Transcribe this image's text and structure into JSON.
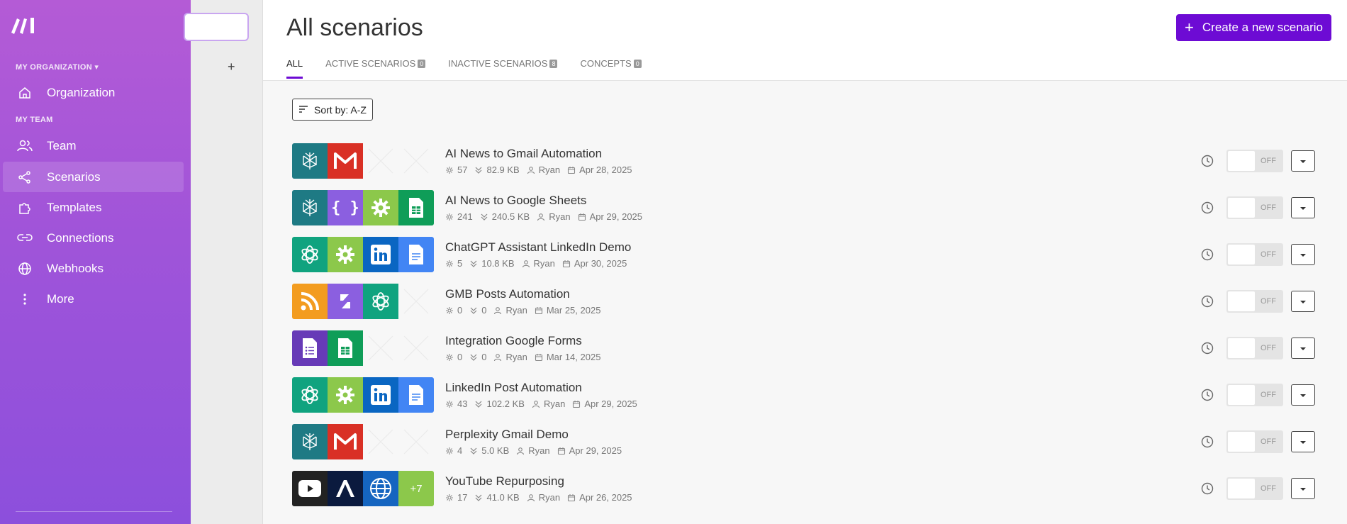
{
  "sidebar": {
    "logo_icon": "make-logo-icon",
    "org_heading": "MY ORGANIZATION",
    "team_heading": "MY TEAM",
    "items": [
      {
        "label": "Organization",
        "icon": "home-icon"
      },
      {
        "label": "Team",
        "icon": "users-icon"
      },
      {
        "label": "Scenarios",
        "icon": "share-nodes-icon"
      },
      {
        "label": "Templates",
        "icon": "puzzle-icon"
      },
      {
        "label": "Connections",
        "icon": "link-icon"
      },
      {
        "label": "Webhooks",
        "icon": "globe-icon"
      },
      {
        "label": "More",
        "icon": "more-vertical-icon"
      }
    ]
  },
  "subpanel": {
    "add_label": "+"
  },
  "header": {
    "title": "All scenarios",
    "create_button": "Create a new scenario",
    "tabs": [
      {
        "label": "ALL",
        "count": ""
      },
      {
        "label": "ACTIVE SCENARIOS",
        "count": "0"
      },
      {
        "label": "INACTIVE SCENARIOS",
        "count": "8"
      },
      {
        "label": "CONCEPTS",
        "count": "0"
      }
    ]
  },
  "sort": {
    "label": "Sort by: A-Z"
  },
  "colors": {
    "accent": "#6d0bd4",
    "sidebar_top": "#b45bd6",
    "sidebar_bottom": "#8c4fdc"
  },
  "scenarios": [
    {
      "name": "AI News to Gmail Automation",
      "operations": "57",
      "data": "82.9 KB",
      "owner": "Ryan",
      "date": "Apr 28, 2025",
      "status": "OFF",
      "apps": [
        {
          "icon": "perplexity-icon",
          "color": "#1e7a84"
        },
        {
          "icon": "gmail-icon",
          "color": "#d93025"
        },
        {
          "icon": "empty",
          "color": ""
        },
        {
          "icon": "empty",
          "color": ""
        }
      ]
    },
    {
      "name": "AI News to Google Sheets",
      "operations": "241",
      "data": "240.5 KB",
      "owner": "Ryan",
      "date": "Apr 29, 2025",
      "status": "OFF",
      "apps": [
        {
          "icon": "perplexity-icon",
          "color": "#1e7a84"
        },
        {
          "icon": "json-icon",
          "color": "#8b5fe0"
        },
        {
          "icon": "tools-gear-icon",
          "color": "#8cc84b"
        },
        {
          "icon": "google-sheets-icon",
          "color": "#0f9d58"
        }
      ]
    },
    {
      "name": "ChatGPT Assistant LinkedIn Demo",
      "operations": "5",
      "data": "10.8 KB",
      "owner": "Ryan",
      "date": "Apr 30, 2025",
      "status": "OFF",
      "apps": [
        {
          "icon": "openai-icon",
          "color": "#10a37f"
        },
        {
          "icon": "tools-gear-icon",
          "color": "#8cc84b"
        },
        {
          "icon": "linkedin-icon",
          "color": "#0a66c2"
        },
        {
          "icon": "google-docs-icon",
          "color": "#4285f4"
        }
      ]
    },
    {
      "name": "GMB Posts Automation",
      "operations": "0",
      "data": "0",
      "owner": "Ryan",
      "date": "Mar 25, 2025",
      "status": "OFF",
      "apps": [
        {
          "icon": "rss-icon",
          "color": "#f39c1f"
        },
        {
          "icon": "flow-control-icon",
          "color": "#8b5fe0"
        },
        {
          "icon": "openai-icon",
          "color": "#10a37f"
        },
        {
          "icon": "empty",
          "color": ""
        }
      ]
    },
    {
      "name": "Integration Google Forms",
      "operations": "0",
      "data": "0",
      "owner": "Ryan",
      "date": "Mar 14, 2025",
      "status": "OFF",
      "apps": [
        {
          "icon": "google-forms-icon",
          "color": "#673ab7"
        },
        {
          "icon": "google-sheets-icon",
          "color": "#0f9d58"
        },
        {
          "icon": "empty",
          "color": ""
        },
        {
          "icon": "empty",
          "color": ""
        }
      ]
    },
    {
      "name": "LinkedIn Post Automation",
      "operations": "43",
      "data": "102.2 KB",
      "owner": "Ryan",
      "date": "Apr 29, 2025",
      "status": "OFF",
      "apps": [
        {
          "icon": "openai-icon",
          "color": "#10a37f"
        },
        {
          "icon": "tools-gear-icon",
          "color": "#8cc84b"
        },
        {
          "icon": "linkedin-icon",
          "color": "#0a66c2"
        },
        {
          "icon": "google-docs-icon",
          "color": "#4285f4"
        }
      ]
    },
    {
      "name": "Perplexity Gmail Demo",
      "operations": "4",
      "data": "5.0 KB",
      "owner": "Ryan",
      "date": "Apr 29, 2025",
      "status": "OFF",
      "apps": [
        {
          "icon": "perplexity-icon",
          "color": "#1e7a84"
        },
        {
          "icon": "gmail-icon",
          "color": "#d93025"
        },
        {
          "icon": "empty",
          "color": ""
        },
        {
          "icon": "empty",
          "color": ""
        }
      ]
    },
    {
      "name": "YouTube Repurposing",
      "operations": "17",
      "data": "41.0 KB",
      "owner": "Ryan",
      "date": "Apr 26, 2025",
      "status": "OFF",
      "apps": [
        {
          "icon": "youtube-icon",
          "color": "#222222"
        },
        {
          "icon": "anthropic-icon",
          "color": "#0b1a3e"
        },
        {
          "icon": "http-globe-icon",
          "color": "#1565c0"
        },
        {
          "icon": "more-apps",
          "color": "#8cc84b",
          "label": "+7"
        }
      ]
    }
  ]
}
